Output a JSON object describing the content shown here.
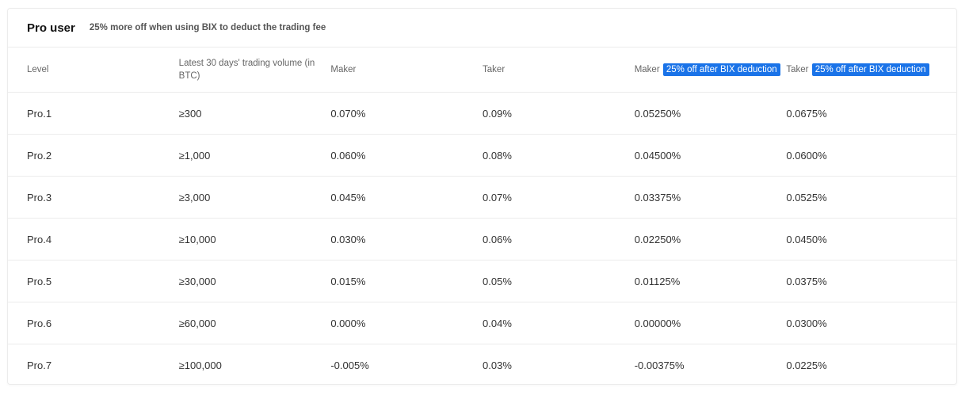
{
  "header": {
    "title": "Pro user",
    "subtitle": "25% more off when using BIX to deduct the trading fee"
  },
  "columns": {
    "level": "Level",
    "volume": "Latest 30 days' trading volume (in BTC)",
    "maker": "Maker",
    "taker": "Taker",
    "maker_bix": "Maker",
    "taker_bix": "Taker",
    "bix_badge": "25% off after BIX deduction"
  },
  "rows": [
    {
      "level": "Pro.1",
      "volume": "≥300",
      "maker": "0.070%",
      "taker": "0.09%",
      "maker_bix": "0.05250%",
      "taker_bix": "0.0675%"
    },
    {
      "level": "Pro.2",
      "volume": "≥1,000",
      "maker": "0.060%",
      "taker": "0.08%",
      "maker_bix": "0.04500%",
      "taker_bix": "0.0600%"
    },
    {
      "level": "Pro.3",
      "volume": "≥3,000",
      "maker": "0.045%",
      "taker": "0.07%",
      "maker_bix": "0.03375%",
      "taker_bix": "0.0525%"
    },
    {
      "level": "Pro.4",
      "volume": "≥10,000",
      "maker": "0.030%",
      "taker": "0.06%",
      "maker_bix": "0.02250%",
      "taker_bix": "0.0450%"
    },
    {
      "level": "Pro.5",
      "volume": "≥30,000",
      "maker": "0.015%",
      "taker": "0.05%",
      "maker_bix": "0.01125%",
      "taker_bix": "0.0375%"
    },
    {
      "level": "Pro.6",
      "volume": "≥60,000",
      "maker": "0.000%",
      "taker": "0.04%",
      "maker_bix": "0.00000%",
      "taker_bix": "0.0300%"
    },
    {
      "level": "Pro.7",
      "volume": "≥100,000",
      "maker": "-0.005%",
      "taker": "0.03%",
      "maker_bix": "-0.00375%",
      "taker_bix": "0.0225%"
    }
  ],
  "colors": {
    "badge": "#1a73e8",
    "border": "#ececec"
  }
}
